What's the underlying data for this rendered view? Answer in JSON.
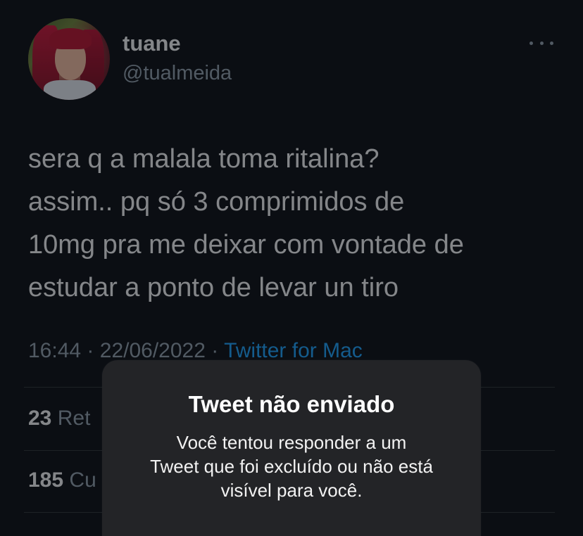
{
  "tweet": {
    "display_name": "tuane",
    "handle": "@tualmeida",
    "text": "sera q a malala toma ritalina?\nassim.. pq só 3 comprimidos de\n10mg pra me deixar com vontade de\nestudar a ponto de levar un tiro",
    "time": "16:44",
    "date": "22/06/2022",
    "separator": "·",
    "source": "Twitter for Mac",
    "retweets_count": "23",
    "retweets_label_visible": "Ret",
    "likes_count": "185",
    "likes_label_visible": "Cu"
  },
  "alert": {
    "title": "Tweet não enviado",
    "message": "Você tentou responder a um\nTweet que foi excluído ou não está\nvisível para você."
  },
  "colors": {
    "background": "#0b0e13",
    "link": "#1d9bf0",
    "muted": "#8b98a5",
    "alert_bg": "#232427"
  }
}
